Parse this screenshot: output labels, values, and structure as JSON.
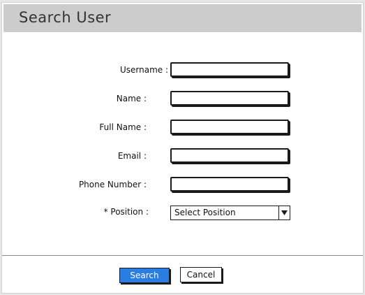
{
  "dialog": {
    "title": "Search User"
  },
  "form": {
    "username_label": "Username :",
    "name_label": "Name :",
    "fullname_label": "Full Name :",
    "email_label": "Email :",
    "phone_label": "Phone Number :",
    "position_label": "* Position :",
    "username_value": "",
    "name_value": "",
    "fullname_value": "",
    "email_value": "",
    "phone_value": "",
    "position_selected": "Select Position"
  },
  "buttons": {
    "search_label": "Search",
    "cancel_label": "Cancel"
  },
  "colors": {
    "primary_button": "#2a7de1",
    "titlebar": "#cccccc"
  }
}
